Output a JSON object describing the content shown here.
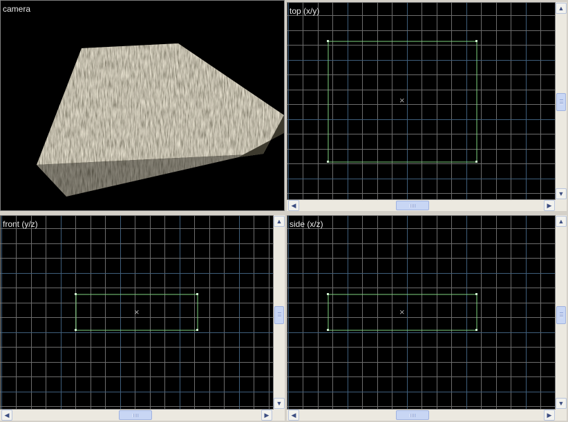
{
  "viewports": {
    "camera": {
      "label": "camera"
    },
    "top": {
      "label": "top (x/y)"
    },
    "front": {
      "label": "front (y/z)"
    },
    "side": {
      "label": "side (x/z)"
    }
  },
  "icons": {
    "scroll_left": "◀",
    "scroll_right": "▶",
    "scroll_up": "▲",
    "scroll_down": "▼",
    "center_marker": "×"
  },
  "colors": {
    "viewport_bg": "#000000",
    "grid_minor": "#6e6e6e",
    "grid_major": "#3f5f7c",
    "brush_outline": "#7fd37f",
    "label_text": "#e8e8e8"
  }
}
